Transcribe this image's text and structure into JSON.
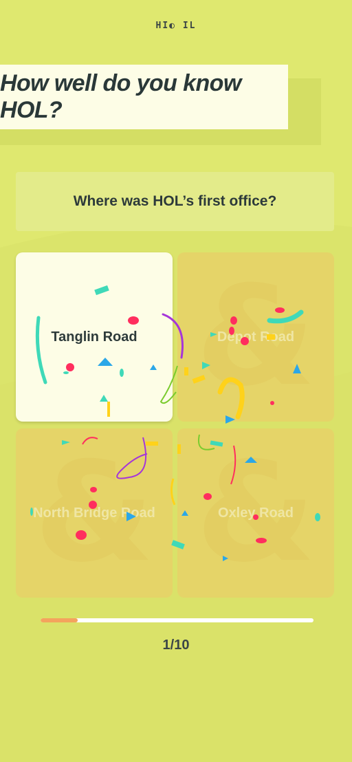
{
  "header": {
    "logo": "HI◐ IL"
  },
  "title": "How well do you know HOL?",
  "question": "Where was HOL’s first office?",
  "answers": [
    {
      "label": "Tanglin Road",
      "selected": true
    },
    {
      "label": "Depot Road",
      "selected": false
    },
    {
      "label": "North Bridge Road",
      "selected": false
    },
    {
      "label": "Oxley Road",
      "selected": false
    }
  ],
  "progress": {
    "fraction": 0.135,
    "counter_text": "1/10"
  },
  "colors": {
    "background": "#dfe86f",
    "card": "#fdfde6",
    "answer_inactive": "#e5d468",
    "progress_fill": "#f4a35d",
    "confetti": [
      "#3fd9b8",
      "#ff2e5e",
      "#a536d9",
      "#2ba7e8",
      "#ffd21a",
      "#7acb2e"
    ]
  }
}
